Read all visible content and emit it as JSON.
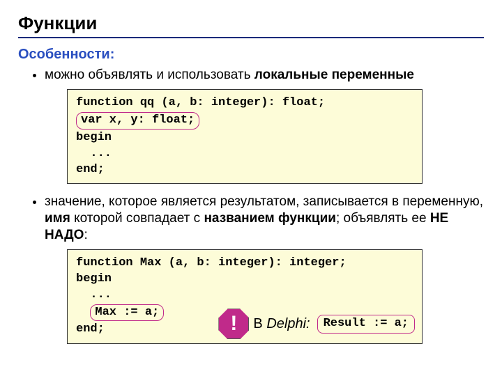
{
  "title": "Функции",
  "subtitle": "Особенности:",
  "bullets": {
    "b1_pre": "можно объявлять и использовать ",
    "b1_bold": "локальные переменные",
    "b2_pre": "значение, которое является результатом, записывается в переменную, ",
    "b2_bold1": "имя",
    "b2_mid1": " которой совпадает с ",
    "b2_bold2": "названием функции",
    "b2_mid2": "; объявлять ее ",
    "b2_bold3": "НЕ НАДО",
    "b2_end": ":"
  },
  "code1": {
    "l1": "function qq (a, b: integer): float;",
    "l2": "var x, y: float;",
    "l3": "begin",
    "l4": "  ...",
    "l5": "end;"
  },
  "code2": {
    "l1": "function Max (a, b: integer): integer;",
    "l2": "begin",
    "l3": "  ...",
    "l4": "Max := a;",
    "l5": "end;"
  },
  "warn": {
    "bang": "!",
    "prefix": "В ",
    "delphi": "Delphi:",
    "result": "Result := a;"
  }
}
